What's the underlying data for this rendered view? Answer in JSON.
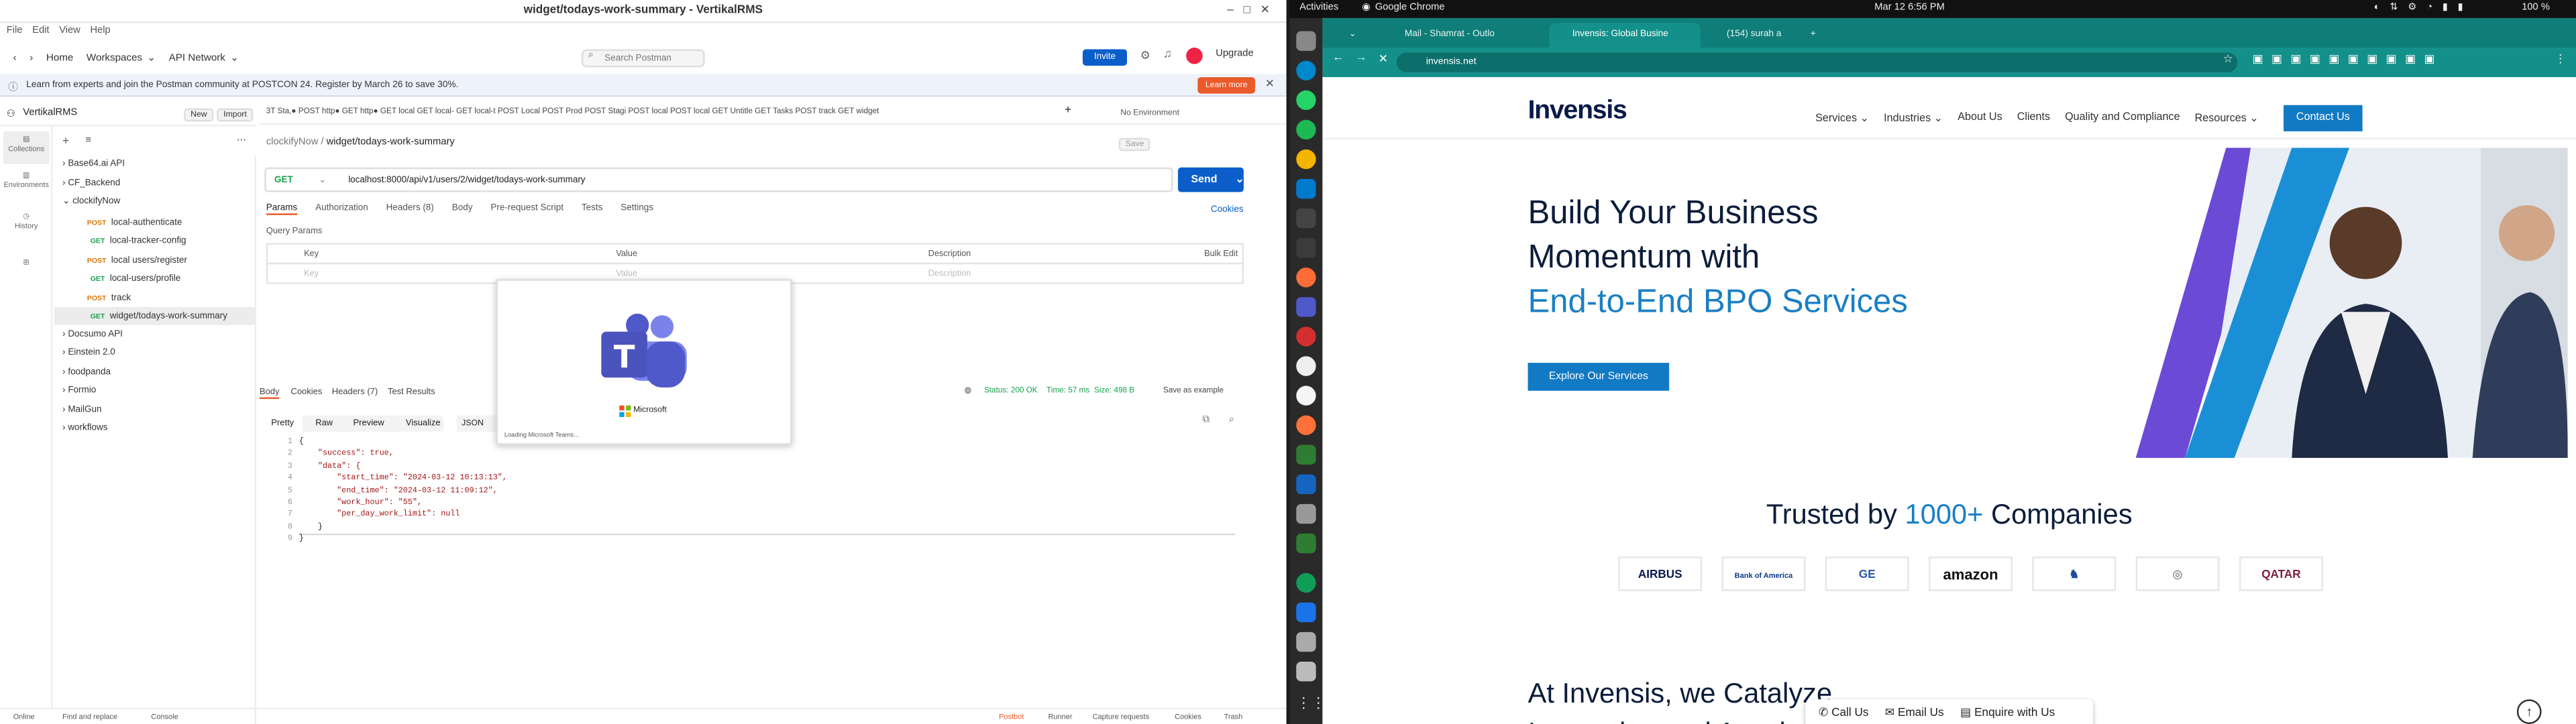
{
  "postman": {
    "window_title": "widget/todays-work-summary - VertikalRMS",
    "menu": [
      "File",
      "Edit",
      "View",
      "Help"
    ],
    "header": {
      "home": "Home",
      "workspaces": "Workspaces",
      "api_network": "API Network",
      "search_placeholder": "Search Postman",
      "invite": "Invite",
      "upgrade": "Upgrade"
    },
    "banner": {
      "text": "Learn from experts and join the Postman community at POSTCON 24. Register by March 26 to save 30%.",
      "button": "Learn more"
    },
    "workspace": {
      "name": "VertikalRMS",
      "new": "New",
      "import": "Import"
    },
    "rail": [
      "Collections",
      "Environments",
      "History"
    ],
    "tree": [
      {
        "label": "Base64.ai API",
        "type": "folder"
      },
      {
        "label": "CF_Backend",
        "type": "folder"
      },
      {
        "label": "clockifyNow",
        "type": "folder-open"
      },
      {
        "label": "local-authenticate",
        "method": "POST"
      },
      {
        "label": "local-tracker-config",
        "method": "GET"
      },
      {
        "label": "local users/register",
        "method": "POST"
      },
      {
        "label": "local-users/profile",
        "method": "GET"
      },
      {
        "label": "track",
        "method": "POST"
      },
      {
        "label": "widget/todays-work-summary",
        "method": "GET",
        "selected": true
      },
      {
        "label": "Docsumo API",
        "type": "folder"
      },
      {
        "label": "Einstein 2.0",
        "type": "folder"
      },
      {
        "label": "foodpanda",
        "type": "folder"
      },
      {
        "label": "Formio",
        "type": "folder"
      },
      {
        "label": "MailGun",
        "type": "folder"
      },
      {
        "label": "workflows",
        "type": "folder"
      }
    ],
    "tabs_strip": "3T Sta,●   POST http●   GET http●   GET local   GET local-   GET local-t   POST Local   POST Prod   POST Stagi   POST local   POST local   GET Untitle   GET Tasks   POST track   GET widget",
    "environment": "No Environment",
    "breadcrumb": {
      "collection": "clockifyNow",
      "request": "widget/todays-work-summary"
    },
    "request": {
      "method": "GET",
      "url": "localhost:8000/api/v1/users/2/widget/todays-work-summary",
      "send": "Send"
    },
    "req_tabs": [
      "Params",
      "Authorization",
      "Headers (8)",
      "Body",
      "Pre-request Script",
      "Tests",
      "Settings"
    ],
    "cookies": "Cookies",
    "query_params": {
      "title": "Query Params",
      "cols": [
        "Key",
        "Value",
        "Description"
      ],
      "bulk": "Bulk Edit",
      "ph": [
        "Key",
        "Value",
        "Description"
      ]
    },
    "response": {
      "tabs": [
        "Body",
        "Cookies",
        "Headers (7)",
        "Test Results"
      ],
      "status": "Status: 200 OK",
      "time": "Time: 57 ms",
      "size": "Size: 498 B",
      "save": "Save as example",
      "views": [
        "Pretty",
        "Raw",
        "Preview",
        "Visualize"
      ],
      "format": "JSON"
    },
    "code": [
      "{",
      "    \"success\": true,",
      "    \"data\": {",
      "        \"start_time\": \"2024-03-12 10:13:13\",",
      "        \"end_time\": \"2024-03-12 11:09:12\",",
      "        \"work_hour\": \"55\",",
      "        \"per_day_work_limit\": null",
      "    }",
      "}"
    ],
    "footer": [
      "Online",
      "Find and replace",
      "Console",
      "Postbot",
      "Runner",
      "Capture requests",
      "Cookies",
      "Trash"
    ],
    "teams_splash": {
      "brand": "Microsoft",
      "status": "Loading Microsoft Teams..."
    }
  },
  "desktop": {
    "activities": "Activities",
    "app": "Google Chrome",
    "clock": "Mar 12  6:56 PM",
    "battery": "100 %",
    "tabs": [
      "Mail - Shamrat - Outlo",
      "Invensis: Global Busine",
      "(154) surah a"
    ],
    "url": "invensis.net",
    "site": {
      "logo": "Invensis",
      "nav": [
        "Services",
        "Industries",
        "About Us",
        "Clients",
        "Quality and Compliance",
        "Resources"
      ],
      "contact": "Contact Us",
      "hero_line1": "Build Your Business",
      "hero_line2": "Momentum with",
      "hero_line3": "End-to-End BPO Services",
      "explore": "Explore Our Services",
      "trusted_a": "Trusted by ",
      "trusted_b": "1000+",
      "trusted_c": " Companies",
      "logos": [
        "AIRBUS",
        "Bank of America",
        "GE",
        "amazon",
        "",
        "",
        "QATAR"
      ],
      "bottom1": "At Invensis, we Catalyze",
      "bottom2": "Innovation and Accelerate",
      "cta": [
        "Call Us",
        "Email Us",
        "Enquire with Us"
      ]
    }
  }
}
